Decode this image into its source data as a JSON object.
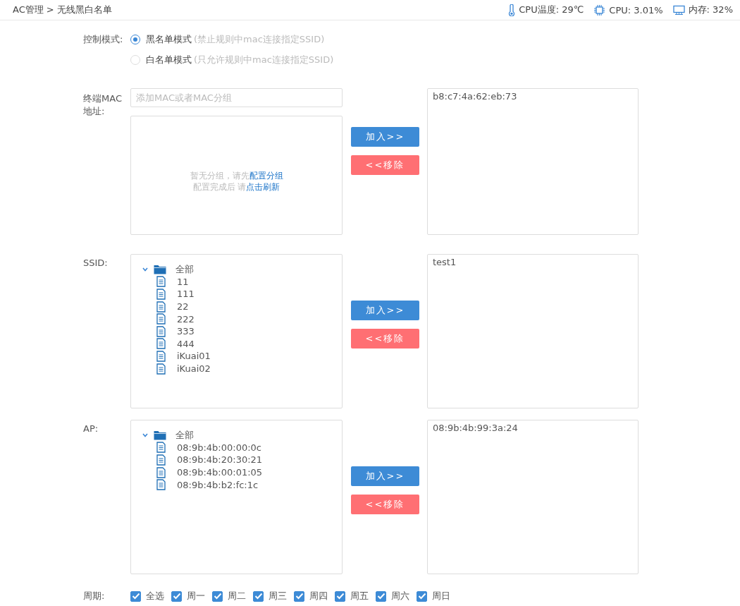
{
  "header": {
    "breadcrumb": "AC管理 > 无线黑白名单",
    "stats": [
      {
        "kind": "temperature",
        "text": "CPU温度: 29℃"
      },
      {
        "kind": "cpu",
        "text": "CPU: 3.01%"
      },
      {
        "kind": "memory",
        "text": "内存: 32%"
      }
    ]
  },
  "control_mode": {
    "label": "控制模式:",
    "options": [
      {
        "label": "黑名单模式",
        "hint": "(禁止规则中mac连接指定SSID)",
        "selected": true
      },
      {
        "label": "白名单模式",
        "hint": "(只允许规则中mac连接指定SSID)",
        "selected": false
      }
    ]
  },
  "sections": [
    {
      "kind": "mac",
      "label": "终端MAC地址:",
      "input": {
        "placeholder": "添加MAC或者MAC分组"
      },
      "empty_message": [
        {
          "text": "暂无分组，请先",
          "link": "配置分组"
        },
        {
          "text": "配置完成后 请",
          "link": "点击刷新"
        }
      ],
      "add_button": "加入>>",
      "remove_button": "<<移除",
      "selected_items": [
        "b8:c7:4a:62:eb:73"
      ]
    },
    {
      "kind": "tree",
      "label": "SSID:",
      "tree": {
        "label": "全部",
        "expanded": true,
        "children": [
          {
            "label": "11"
          },
          {
            "label": "111"
          },
          {
            "label": "22"
          },
          {
            "label": "222"
          },
          {
            "label": "333"
          },
          {
            "label": "444"
          },
          {
            "label": "iKuai01"
          },
          {
            "label": "iKuai02"
          }
        ]
      },
      "add_button": "加入>>",
      "remove_button": "<<移除",
      "selected_items": [
        "test1"
      ]
    },
    {
      "kind": "tree",
      "label": "AP:",
      "tree": {
        "label": "全部",
        "expanded": true,
        "children": [
          {
            "label": "08:9b:4b:00:00:0c"
          },
          {
            "label": "08:9b:4b:20:30:21"
          },
          {
            "label": "08:9b:4b:00:01:05"
          },
          {
            "label": "08:9b:4b:b2:fc:1c"
          }
        ]
      },
      "add_button": "加入>>",
      "remove_button": "<<移除",
      "selected_items": [
        "08:9b:4b:99:3a:24"
      ]
    }
  ],
  "period": {
    "label": "周期:",
    "days": [
      {
        "label": "全选",
        "checked": true
      },
      {
        "label": "周一",
        "checked": true
      },
      {
        "label": "周二",
        "checked": true
      },
      {
        "label": "周三",
        "checked": true
      },
      {
        "label": "周四",
        "checked": true
      },
      {
        "label": "周五",
        "checked": true
      },
      {
        "label": "周六",
        "checked": true
      },
      {
        "label": "周日",
        "checked": true
      }
    ]
  }
}
